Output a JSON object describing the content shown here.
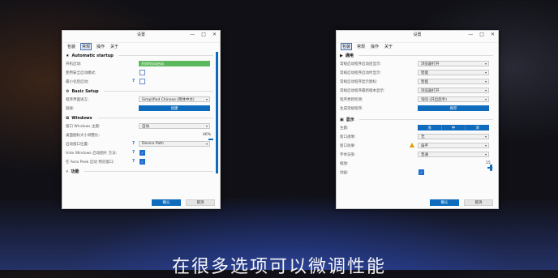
{
  "left": {
    "title": "设置",
    "window_controls": [
      "—",
      "□",
      "✕"
    ],
    "menu": [
      "包装",
      "常规",
      "操作",
      "关于"
    ],
    "active_menu": 1,
    "sections": {
      "auto": {
        "title": "Automatic startup",
        "rows": [
          {
            "label": "开机启动:",
            "value": "开机时自动启动"
          },
          {
            "label": "使用安全启动模式:"
          },
          {
            "label": "最小化后启动:",
            "help": "?"
          }
        ]
      },
      "basic": {
        "title": "Basic Setup",
        "rows": [
          {
            "label": "程序界面语言:",
            "value": "Simplified Chinese (简体中文)"
          },
          {
            "label": "链接:",
            "button": "创建"
          }
        ]
      },
      "windows": {
        "title": "Windows",
        "rows": [
          {
            "label": "窗口 Windows 主题:",
            "value": "自动"
          },
          {
            "label": "桌面图标大小调整比:",
            "value": "46%"
          },
          {
            "label": "启动窗口位置:",
            "value": "Device Path",
            "help": "?"
          },
          {
            "label": "Hide Windows 启动图片 方法:",
            "help": "?"
          },
          {
            "label": "在 Aero Peek 启动 预览窗口:",
            "help": "?"
          }
        ],
        "slider_fraction": 0.46
      },
      "more": {
        "title": "功能"
      }
    },
    "footer": {
      "ok": "确认",
      "cancel": "取消"
    }
  },
  "right": {
    "title": "设置",
    "window_controls": [
      "—",
      "□",
      "✕"
    ],
    "menu": [
      "包装",
      "常规",
      "操作",
      "关于"
    ],
    "active_menu": 0,
    "sections": {
      "general": {
        "title": "通用",
        "rows": [
          {
            "label": "常规启动程序启动后显示:",
            "value": "浏览器打开"
          },
          {
            "label": "常规启动程序启动时显示:",
            "value": "智能"
          },
          {
            "label": "常规启动程序显示图标:",
            "value": "智能"
          },
          {
            "label": "常规启动程序最新版本显示:",
            "value": "浏览器打开"
          },
          {
            "label": "程序更新检测:",
            "value": "询问 (开启后手)"
          },
          {
            "label": "生成常规程序:",
            "button": "保存"
          }
        ]
      },
      "style": {
        "title": "显示",
        "rows": [
          {
            "label": "主题:",
            "segments": [
              "浅",
              "中",
              "深"
            ]
          },
          {
            "label": "窗口透明:",
            "value": "无"
          },
          {
            "label": "窗口效果:",
            "value": "扁平",
            "warn": true
          },
          {
            "label": "字体渲染:",
            "value": "普通"
          },
          {
            "label": "缩放:",
            "value": "15"
          },
          {
            "label": "动画:"
          }
        ],
        "slider_fraction": 0.05
      }
    },
    "footer": {
      "ok": "确认",
      "cancel": "取消"
    }
  },
  "caption": "在很多选项可以微调性能"
}
